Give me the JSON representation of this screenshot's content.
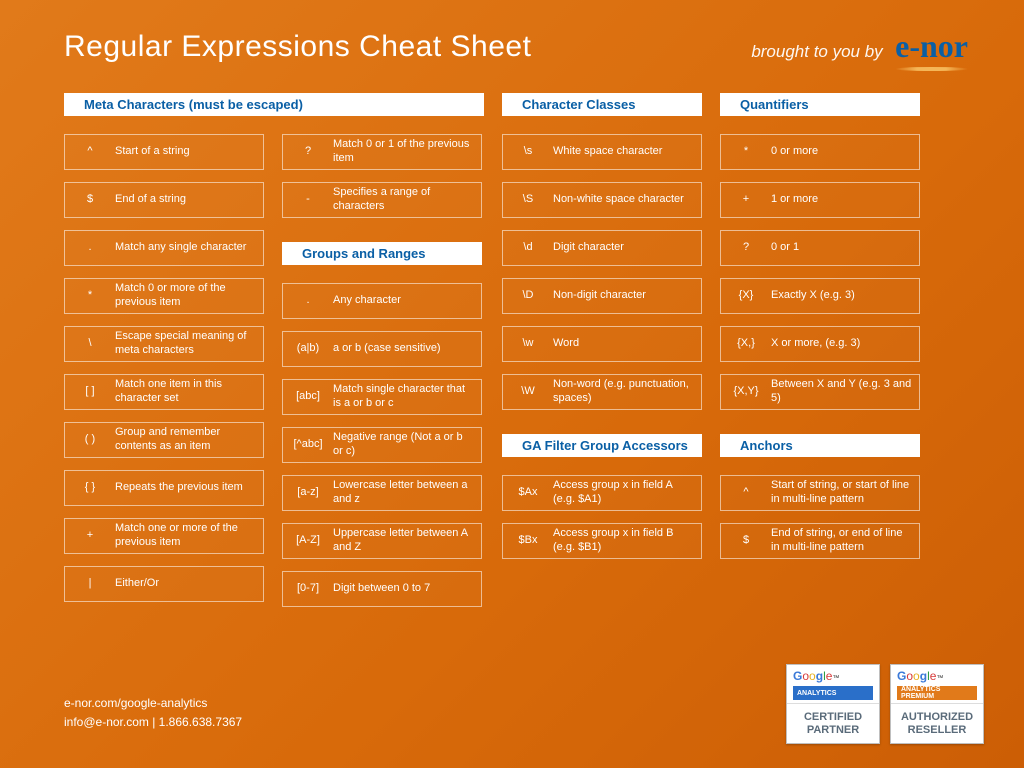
{
  "header": {
    "title": "Regular Expressions Cheat Sheet",
    "brought": "brought to you by",
    "logo": "e-nor"
  },
  "sections": {
    "meta": "Meta Characters (must be escaped)",
    "groups": "Groups and Ranges",
    "classes": "Character Classes",
    "accessors": "GA Filter Group Accessors",
    "quant": "Quantifiers",
    "anchors": "Anchors"
  },
  "meta1": [
    {
      "s": "^",
      "d": "Start of a string"
    },
    {
      "s": "$",
      "d": "End of a string"
    },
    {
      "s": ".",
      "d": "Match any single character"
    },
    {
      "s": "*",
      "d": "Match 0 or more of the previous item"
    },
    {
      "s": "\\",
      "d": "Escape special meaning of meta characters"
    },
    {
      "s": "[ ]",
      "d": "Match one item in this character set"
    },
    {
      "s": "( )",
      "d": "Group and remember contents as an item"
    },
    {
      "s": "{ }",
      "d": "Repeats the previous item"
    },
    {
      "s": "+",
      "d": "Match one or more of the previous item"
    },
    {
      "s": "|",
      "d": "Either/Or"
    }
  ],
  "meta2": [
    {
      "s": "?",
      "d": "Match 0 or 1 of the previous item"
    },
    {
      "s": "-",
      "d": "Specifies a range of characters"
    }
  ],
  "groups": [
    {
      "s": ".",
      "d": "Any character"
    },
    {
      "s": "(a|b)",
      "d": "a or b (case sensitive)"
    },
    {
      "s": "[abc]",
      "d": "Match single character that is a or b or c"
    },
    {
      "s": "[^abc]",
      "d": "Negative range (Not a or b or c)"
    },
    {
      "s": "[a-z]",
      "d": "Lowercase letter between a and z"
    },
    {
      "s": "[A-Z]",
      "d": "Uppercase letter between A and Z"
    },
    {
      "s": "[0-7]",
      "d": "Digit between 0 to 7"
    }
  ],
  "classes": [
    {
      "s": "\\s",
      "d": "White space character"
    },
    {
      "s": "\\S",
      "d": "Non-white space character"
    },
    {
      "s": "\\d",
      "d": "Digit character"
    },
    {
      "s": "\\D",
      "d": "Non-digit character"
    },
    {
      "s": "\\w",
      "d": "Word"
    },
    {
      "s": "\\W",
      "d": "Non-word (e.g. punctuation, spaces)"
    }
  ],
  "accessors": [
    {
      "s": "$Ax",
      "d": "Access group x in field A (e.g. $A1)"
    },
    {
      "s": "$Bx",
      "d": "Access group x in field B (e.g. $B1)"
    }
  ],
  "quant": [
    {
      "s": "*",
      "d": "0 or more"
    },
    {
      "s": "+",
      "d": "1 or more"
    },
    {
      "s": "?",
      "d": "0 or 1"
    },
    {
      "s": "{X}",
      "d": "Exactly X (e.g. 3)"
    },
    {
      "s": "{X,}",
      "d": "X or more, (e.g. 3)"
    },
    {
      "s": "{X,Y}",
      "d": "Between X and Y (e.g. 3 and 5)"
    }
  ],
  "anchors": [
    {
      "s": "^",
      "d": "Start of string, or start of line in multi-line pattern"
    },
    {
      "s": "$",
      "d": "End of string, or end of line in multi-line pattern"
    }
  ],
  "footer": {
    "line1": "e-nor.com/google-analytics",
    "line2": "info@e-nor.com | 1.866.638.7367"
  },
  "badges": {
    "b1": {
      "bar": "ANALYTICS",
      "big": "CERTIFIED PARTNER"
    },
    "b2": {
      "bar": "ANALYTICS PREMIUM",
      "big": "AUTHORIZED RESELLER"
    }
  }
}
